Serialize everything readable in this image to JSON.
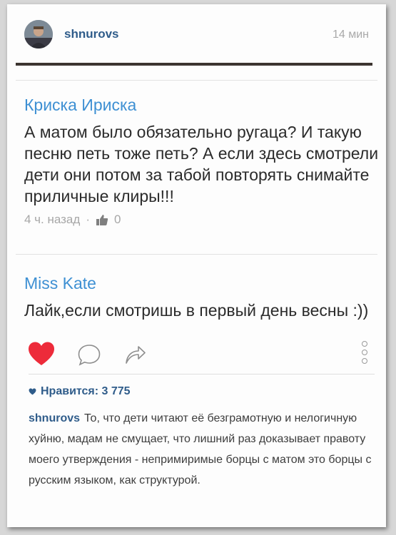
{
  "post": {
    "username": "shnurovs",
    "time": "14 мин"
  },
  "comments": [
    {
      "author": "Криска Ириска",
      "text": "А матом было обязательно ругаца? И такую песню петь тоже петь? А если здесь смотрели дети они потом за табой повторять снимайте приличные клиры!!!",
      "time_ago": "4 ч. назад",
      "separator": "·",
      "likes": "0"
    },
    {
      "author": "Miss Kate",
      "text": "Лайк,если смотришь в первый день весны :))"
    }
  ],
  "actions": {
    "like_icon": "heart-icon",
    "like_color": "#ed2b3a",
    "comment_icon": "comment-bubble-icon",
    "share_icon": "share-arrow-icon",
    "more_icon": "more-options-icon"
  },
  "likes_line": "Нравится: 3 775",
  "caption": {
    "user": "shnurovs",
    "text": "То, что дети читают её безграмотную и нелогичную хуйню, мадам не смущает, что лишний раз доказывает правоту моего утверждения - непримиримые борцы с матом это борцы с русским языком, как структурой."
  }
}
